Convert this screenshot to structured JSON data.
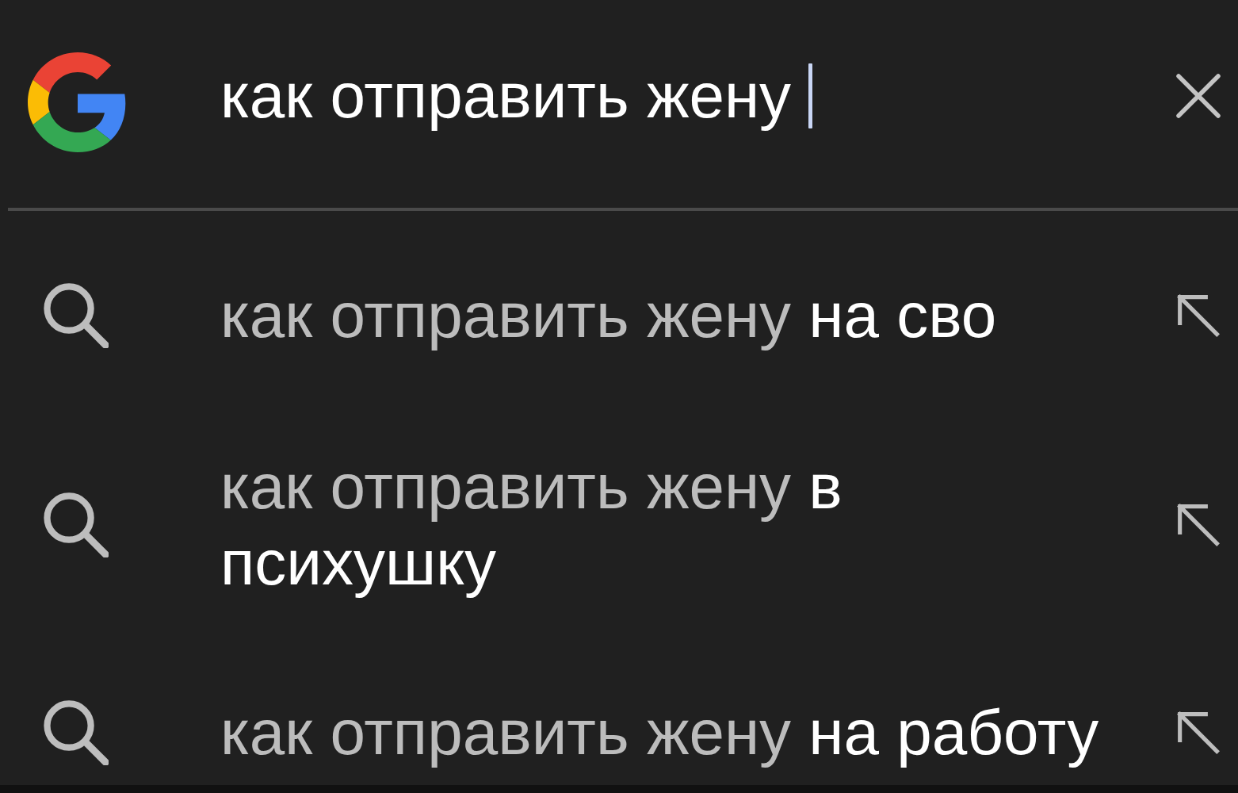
{
  "search": {
    "value": "как отправить жену",
    "focused": true
  },
  "suggestions": [
    {
      "prefix": "как отправить жену",
      "completion": "на сво"
    },
    {
      "prefix": "как отправить жену",
      "completion": "в психушку"
    },
    {
      "prefix": "как отправить жену",
      "completion": "на работу"
    }
  ]
}
